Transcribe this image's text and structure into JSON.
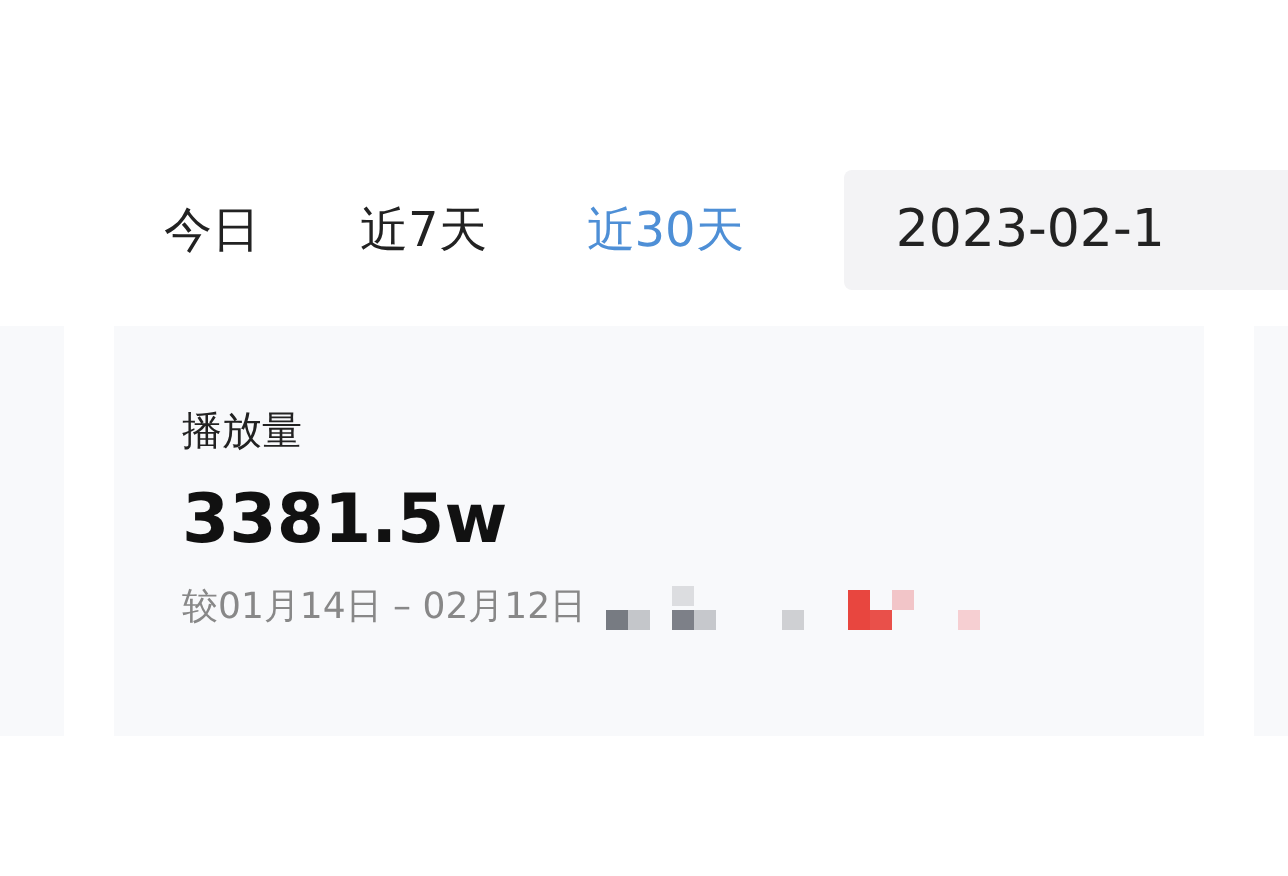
{
  "tabs": [
    {
      "label": "今日",
      "selected": false
    },
    {
      "label": "近7天",
      "selected": false
    },
    {
      "label": "近30天",
      "selected": true
    }
  ],
  "date_field": {
    "value": "2023-02-1"
  },
  "cards": [
    {
      "title": "播放量",
      "value": "3381.5w",
      "compare": "较01月14日 – 02月12日"
    }
  ]
}
